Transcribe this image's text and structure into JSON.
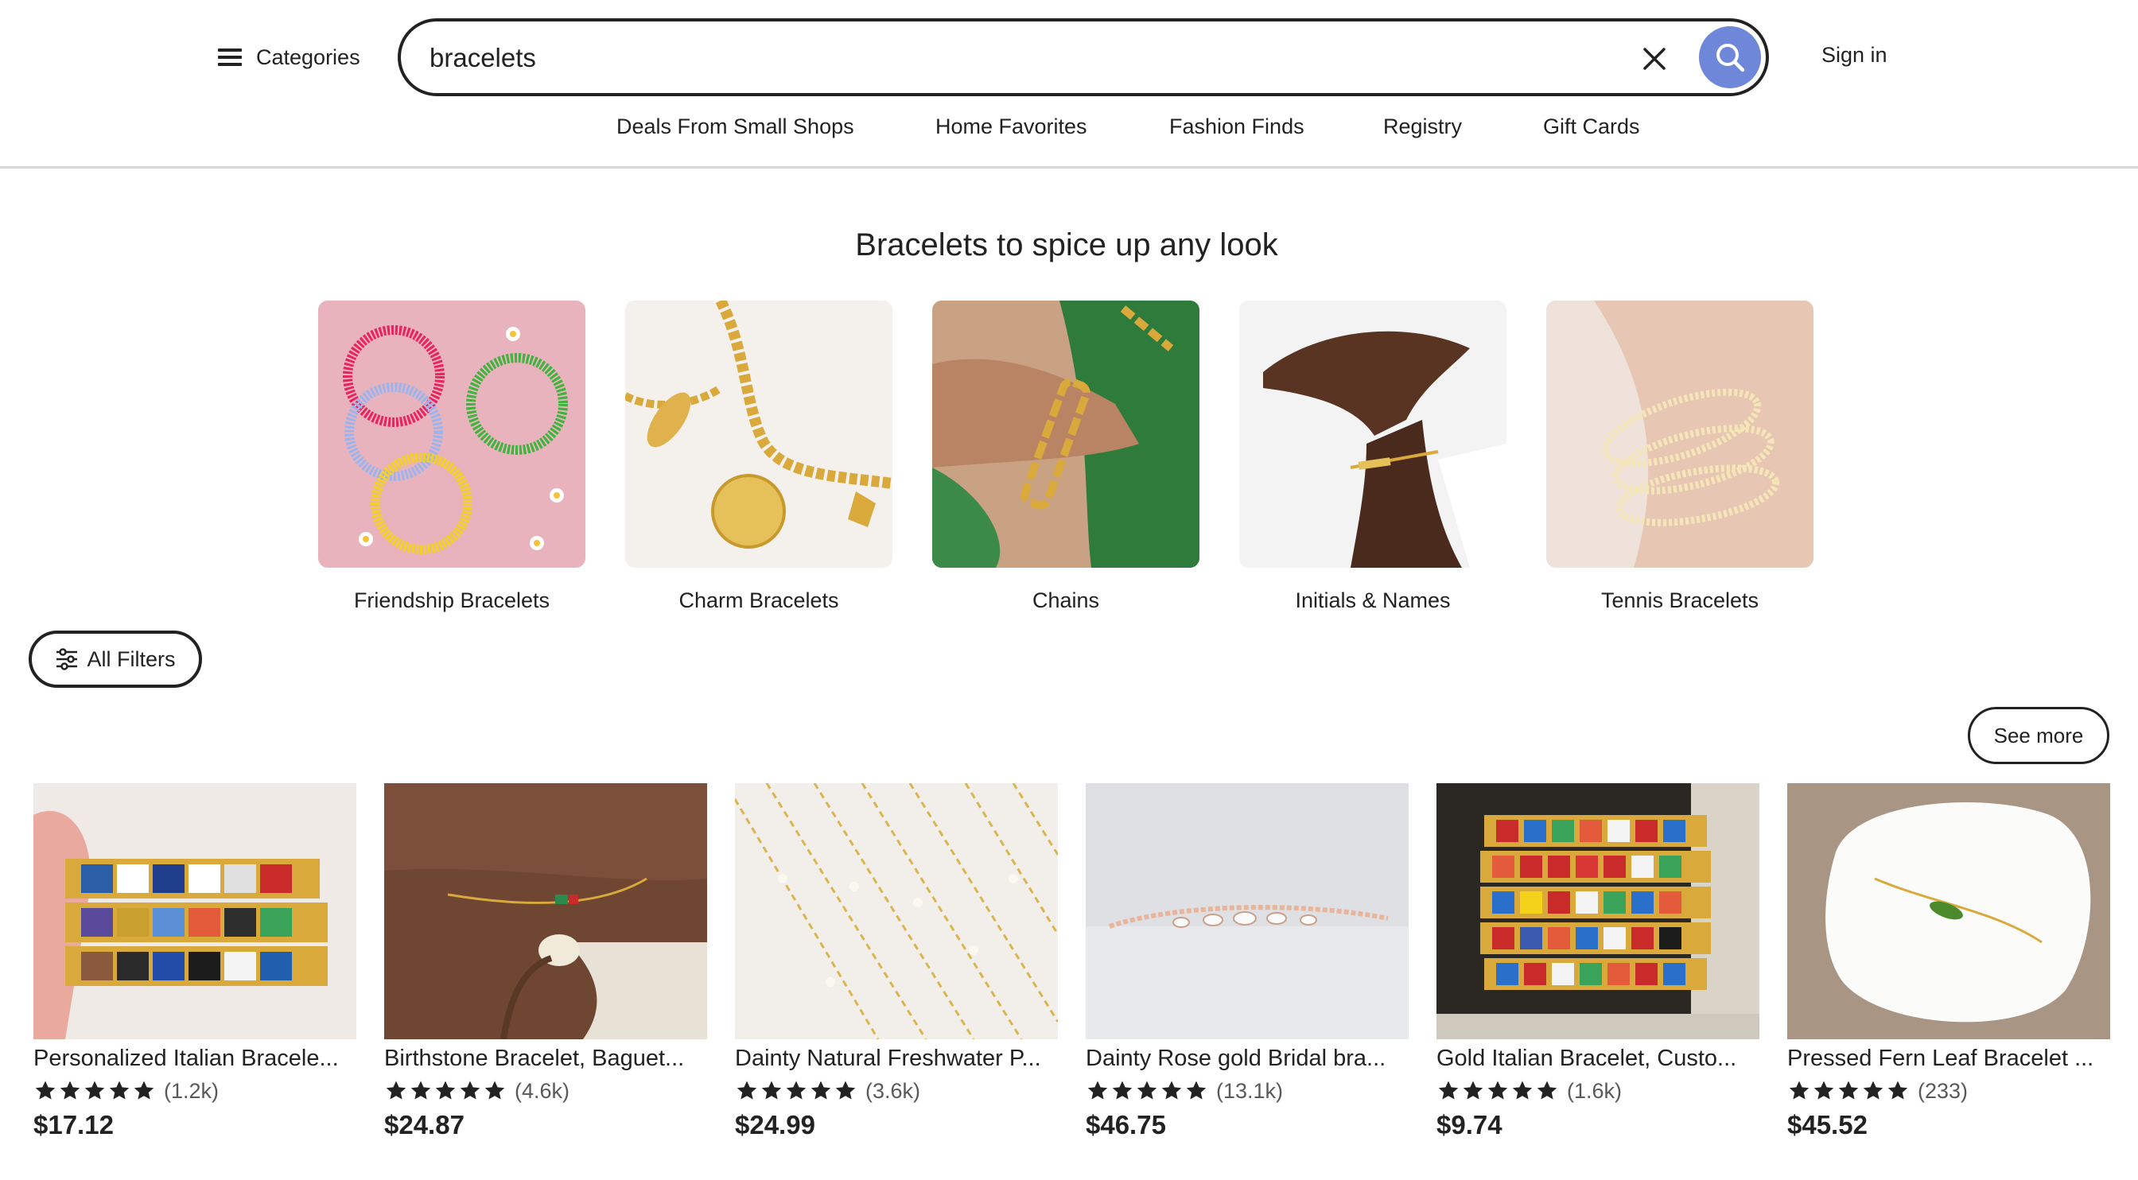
{
  "header": {
    "categories_label": "Categories",
    "search_value": "bracelets",
    "signin_label": "Sign in",
    "accent_color": "#6f87d8"
  },
  "nav": {
    "items": [
      "Deals From Small Shops",
      "Home Favorites",
      "Fashion Finds",
      "Registry",
      "Gift Cards"
    ]
  },
  "section": {
    "title": "Bracelets to spice up any look",
    "categories": [
      {
        "label": "Friendship Bracelets"
      },
      {
        "label": "Charm Bracelets"
      },
      {
        "label": "Chains"
      },
      {
        "label": "Initials & Names"
      },
      {
        "label": "Tennis Bracelets"
      }
    ]
  },
  "filters": {
    "all_filters_label": "All Filters",
    "see_more_label": "See more"
  },
  "products": [
    {
      "title": "Personalized Italian Bracele...",
      "rating": 5,
      "reviews": "(1.2k)",
      "price": "$17.12"
    },
    {
      "title": "Birthstone Bracelet, Baguet...",
      "rating": 5,
      "reviews": "(4.6k)",
      "price": "$24.87"
    },
    {
      "title": "Dainty Natural Freshwater P...",
      "rating": 5,
      "reviews": "(3.6k)",
      "price": "$24.99"
    },
    {
      "title": "Dainty Rose gold Bridal bra...",
      "rating": 5,
      "reviews": "(13.1k)",
      "price": "$46.75"
    },
    {
      "title": "Gold Italian Bracelet, Custo...",
      "rating": 5,
      "reviews": "(1.6k)",
      "price": "$9.74"
    },
    {
      "title": "Pressed Fern Leaf Bracelet ...",
      "rating": 5,
      "reviews": "(233)",
      "price": "$45.52"
    }
  ]
}
